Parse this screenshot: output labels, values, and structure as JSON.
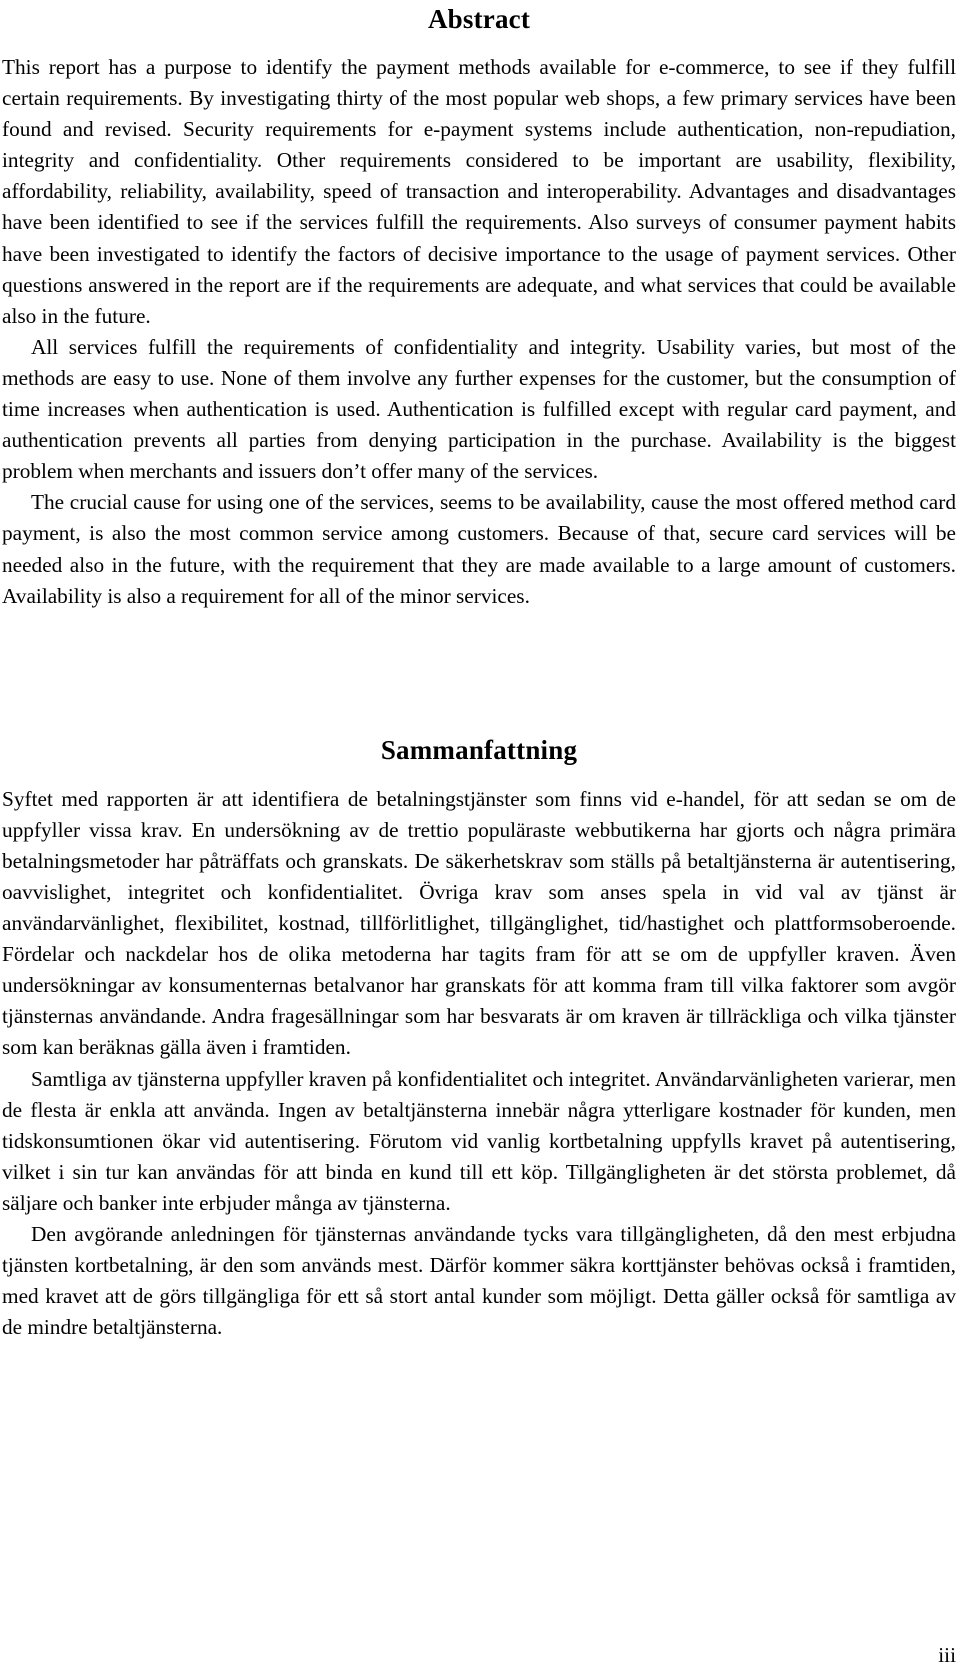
{
  "document": {
    "page_number": "iii",
    "sections": [
      {
        "id": "abstract",
        "title": "Abstract",
        "paragraphs": [
          "This report has a purpose to identify the payment methods available for e-commerce, to see if they fulfill certain requirements. By investigating thirty of the most popular web shops, a few primary services have been found and revised. Security requirements for e-payment systems include authentication, non-repudiation, integrity and confidentiality. Other requirements considered to be important are usability, flexibility, affordability, reliability, availability, speed of transaction and interoperability. Advantages and disadvantages have been identified to see if the services fulfill the requirements. Also surveys of consumer payment habits have been investigated to identify the factors of decisive importance to the usage of payment services. Other questions answered in the report are if the requirements are adequate, and what services that could be available also in the future.",
          "All services fulfill the requirements of confidentiality and integrity. Usability varies, but most of the methods are easy to use. None of them involve any further expenses for the customer, but the consumption of time increases when authentication is used. Authentication is fulfilled except with regular card payment, and authentication prevents all parties from denying participation in the purchase. Availability is the biggest problem when merchants and issuers don’t offer many of the services.",
          "The crucial cause for using one of the services, seems to be availability, cause the most offered method card payment, is also the most common service among customers. Because of that, secure card services will be needed also in the future, with the requirement that they are made available to a large amount of customers. Availability is also a requirement for all of the minor services."
        ]
      },
      {
        "id": "sammanfattning",
        "title": "Sammanfattning",
        "paragraphs": [
          "Syftet med rapporten är att identifiera de betalningstjänster som finns vid e-handel, för att sedan se om de uppfyller vissa krav. En undersökning av de trettio populäraste webbutikerna har gjorts och några primära betalningsmetoder har påträffats och granskats. De säkerhetskrav som ställs på betaltjänsterna är autentisering, oavvislighet, integritet och konfidentialitet. Övriga krav som anses spela in vid val av tjänst är användarvänlighet, flexibilitet, kostnad, tillförlitlighet, tillgänglighet, tid/hastighet och plattformsoberoende. Fördelar och nackdelar hos de olika metoderna har tagits fram för att se om de uppfyller kraven. Även undersökningar av konsumenternas betalvanor har granskats för att komma fram till vilka faktorer som avgör tjänsternas användande. Andra fragesällningar som har besvarats är om kraven är tillräckliga och vilka tjänster som kan beräknas gälla även i framtiden.",
          "Samtliga av tjänsterna uppfyller kraven på konfidentialitet och integritet. Användarvänligheten varierar, men de flesta är enkla att använda. Ingen av betaltjänsterna innebär några ytterligare kostnader för kunden, men tidskonsumtionen ökar vid autentisering. Förutom vid vanlig kortbetalning uppfylls kravet på autentisering, vilket i sin tur kan användas för att binda en kund till ett köp. Tillgängligheten är det största problemet, då säljare och banker inte erbjuder många av tjänsterna.",
          "Den avgörande anledningen för tjänsternas användande tycks vara tillgängligheten, då den mest erbjudna tjänsten kortbetalning, är den som används mest. Därför kommer säkra korttjänster behövas också i framtiden, med kravet att de görs tillgängliga för ett så stort antal kunder som möjligt. Detta gäller också för samtliga av de mindre betaltjänsterna."
        ]
      }
    ]
  }
}
